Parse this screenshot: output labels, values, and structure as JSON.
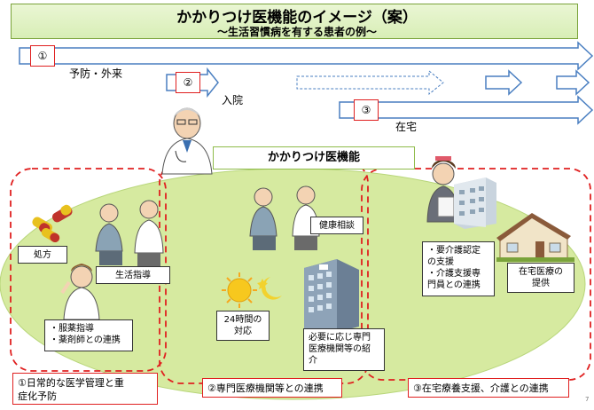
{
  "header": {
    "title": "かかりつけ医機能のイメージ（案）",
    "subtitle": "～生活習慣病を有する患者の例～"
  },
  "timeline": [
    {
      "number": "①",
      "label": "予防・外来"
    },
    {
      "number": "②",
      "label": "入院"
    },
    {
      "number": "③",
      "label": "在宅"
    }
  ],
  "banner": "かかりつけ医機能",
  "boxes": {
    "prescription": "処方",
    "lifestyle": "生活指導",
    "medication_line1": "・服薬指導",
    "medication_line2": "・薬剤師との連携",
    "health_consult": "健康相談",
    "hours24_line1": "24時間の",
    "hours24_line2": "対応",
    "referral_line1": "必要に応じ専門",
    "referral_line2": "医療機関等の紹",
    "referral_line3": "介",
    "care_line1": "・要介護認定",
    "care_line2": "の支援",
    "care_line3": "・介護支援専",
    "care_line4": "門員との連携",
    "home_care_line1": "在宅医療の",
    "home_care_line2": "提供"
  },
  "sections": [
    {
      "label_line1": "①日常的な医学管理と重",
      "label_line2": "症化予防"
    },
    {
      "label_line1": "②専門医療機関等との連携"
    },
    {
      "label_line1": "③在宅療養支援、介護との連携"
    }
  ],
  "page_number": "7",
  "colors": {
    "arrow_fill": "#ffffff",
    "arrow_stroke": "#4a7fc1",
    "ellipse": "#d6eaa0",
    "dashed": "#e02020",
    "banner_border": "#8fbb4a"
  }
}
